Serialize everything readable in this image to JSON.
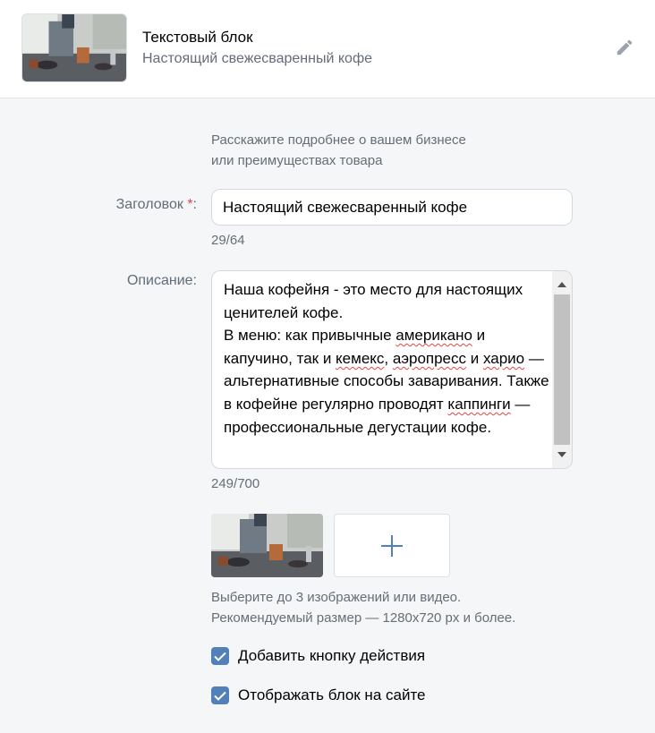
{
  "header": {
    "title": "Текстовый блок",
    "subtitle": "Настоящий свежесваренный кофе"
  },
  "form": {
    "hint_line1": "Расскажите подробнее о вашем бизнесе",
    "hint_line2": "или преимуществах товара",
    "title_label": "Заголовок",
    "required_mark": "*",
    "title_colon": ":",
    "title_value": "Настоящий свежесваренный кофе",
    "title_counter": "29/64",
    "desc_label": "Описание:",
    "desc_text": {
      "p1": "Наша кофейня - это место для настоящих ценителей кофе.\nВ меню: как привычные ",
      "w1": "американо",
      "p2": " и капучино, так и ",
      "w2": "кемекс",
      "p3": ", ",
      "w3": "аэропресс",
      "p4": " и ",
      "w4": "харио",
      "p5": " — альтернативные способы заваривания. Также в кофейне регулярно проводят ",
      "w5": "каппинги",
      "p6": " — профессиональные дегустации кофе."
    },
    "desc_counter": "249/700",
    "images_hint_line1": "Выберите до 3 изображений или видео.",
    "images_hint_line2": "Рекомендуемый размер — 1280x720 px и более."
  },
  "checkboxes": [
    {
      "label": "Добавить кнопку действия",
      "checked": true
    },
    {
      "label": "Отображать блок на сайте",
      "checked": true
    }
  ],
  "icons": {
    "edit": "pencil-icon",
    "add": "plus-icon",
    "check": "check-icon"
  },
  "colors": {
    "accent": "#5181b8",
    "muted_text": "#626d7a",
    "required": "#e64646",
    "background": "#f5f6f8"
  }
}
